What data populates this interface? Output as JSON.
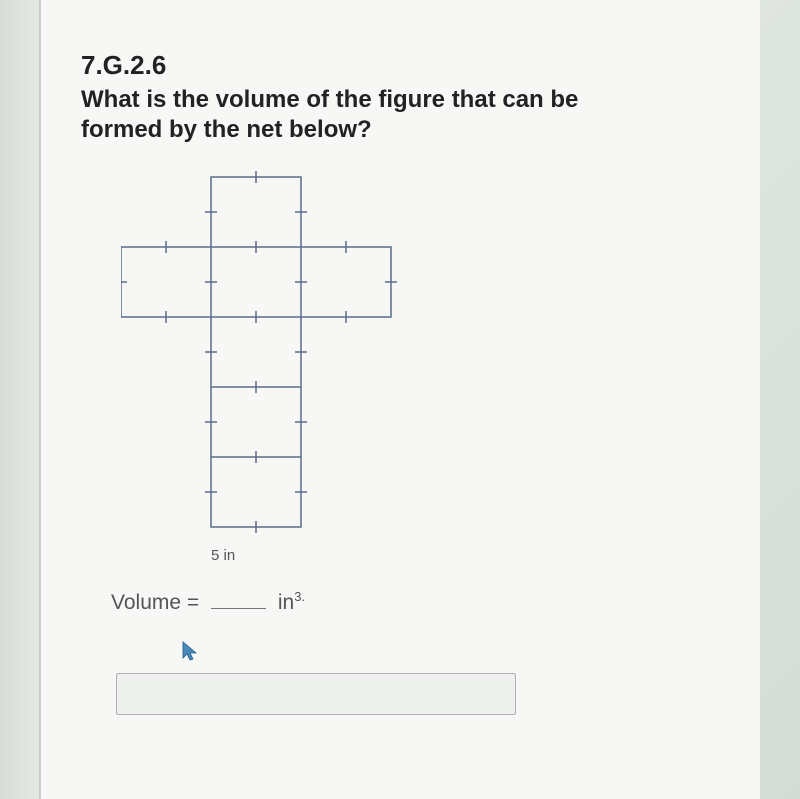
{
  "standard_code": "7.G.2.6",
  "question_text": "What is the volume of the figure that can be formed by the net below?",
  "dimension_label": "5 in",
  "answer_prefix": "Volume =",
  "answer_unit": "in",
  "answer_unit_exponent": "3.",
  "net": {
    "cell_size_units": 1,
    "row_width_units": 3,
    "column_height_units": 5,
    "dimension_label_value": "5 in"
  }
}
